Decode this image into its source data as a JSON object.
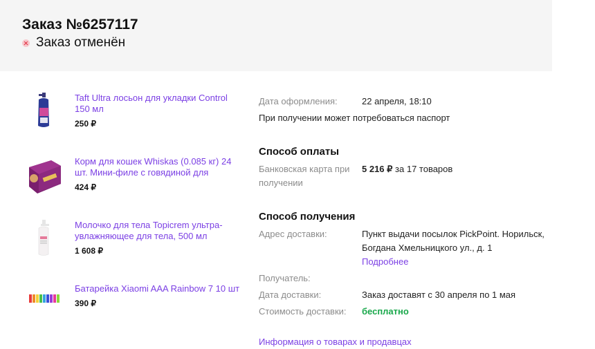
{
  "header": {
    "order_title": "Заказ №6257117",
    "status": "Заказ отменён"
  },
  "products": [
    {
      "name": "Taft Ultra лосьон для укладки Control 150 мл",
      "price": "250 ₽",
      "icon": "spray-bottle-icon"
    },
    {
      "name": "Корм для кошек Whiskas (0.085 кг) 24 шт. Мини-филе с говядиной для",
      "price": "424 ₽",
      "icon": "cat-food-box-icon"
    },
    {
      "name": "Молочко для тела Topicrem ультра-увлажняющее для тела, 500 мл",
      "price": "1 608 ₽",
      "icon": "lotion-bottle-icon"
    },
    {
      "name": "Батарейка Xiaomi AAA Rainbow 7 10 шт",
      "price": "390 ₽",
      "icon": "batteries-icon"
    }
  ],
  "details": {
    "order_date_label": "Дата оформления:",
    "order_date_value": "22 апреля, 18:10",
    "passport_note": "При получении может потребоваться паспорт",
    "payment_title": "Способ оплаты",
    "payment_label": "Банковская карта при получении",
    "payment_amount": "5 216 ₽",
    "payment_items": " за 17 товаров",
    "delivery_title": "Способ получения",
    "address_label": "Адрес доставки:",
    "address_value": "Пункт выдачи посылок PickPoint. Норильск, Богдана Хмельницкого ул., д. 1",
    "more_link": "Подробнее",
    "recipient_label": "Получатель:",
    "delivery_date_label": "Дата доставки:",
    "delivery_date_value": "Заказ доставят с 30 апреля по 1 мая",
    "delivery_cost_label": "Стоимость доставки:",
    "delivery_cost_value": "бесплатно",
    "info_link": "Информация о товарах и продавцах"
  },
  "colors": {
    "accent": "#7b3fe4",
    "success": "#19a84b",
    "error": "#e0283c"
  }
}
